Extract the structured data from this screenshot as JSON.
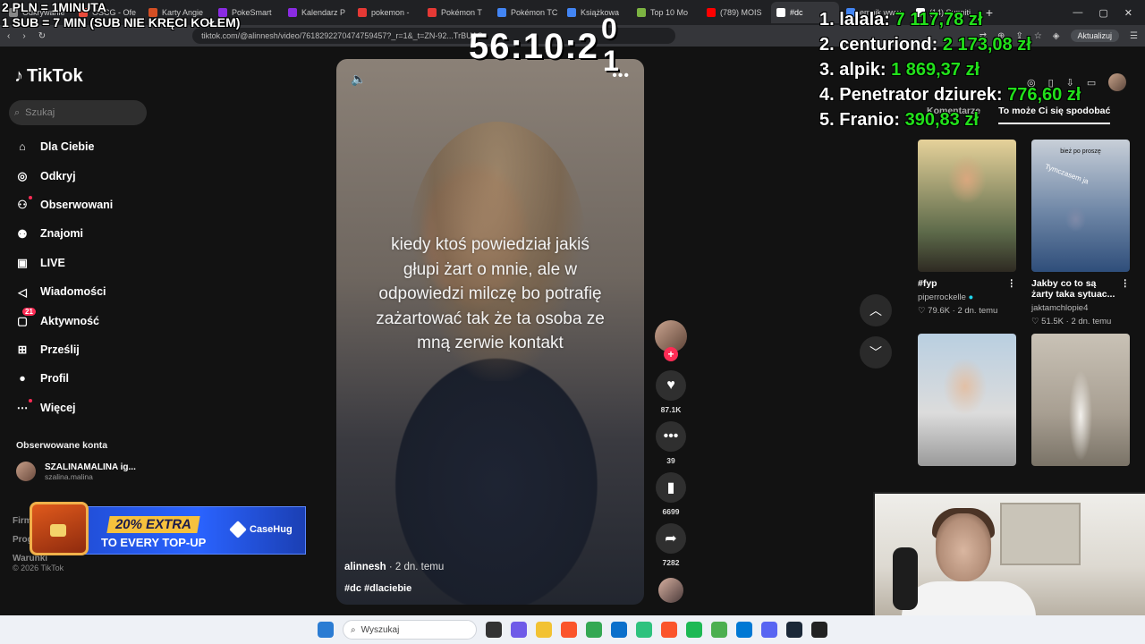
{
  "overlay": {
    "line1": "2 PLN =  1MINUTA",
    "line2": "1 SUB = 7 MIN (SUB NIE KRĘCI KOŁEM)",
    "timer": "56:10:2",
    "timer_digit_top": "0",
    "timer_digit_bottom": "1"
  },
  "leaderboard": [
    {
      "rank": "1.",
      "name": "lalala:",
      "amount": "7 117,78 zł"
    },
    {
      "rank": "2.",
      "name": "centuriond:",
      "amount": "2 173,08 zł"
    },
    {
      "rank": "3.",
      "name": "alpik:",
      "amount": "1 869,37 zł"
    },
    {
      "rank": "4.",
      "name": "Penetrator dziurek:",
      "amount": "776,60 zł"
    },
    {
      "rank": "5.",
      "name": "Franio:",
      "amount": "390,83 zł"
    }
  ],
  "browser": {
    "tabs": [
      {
        "label": "Odkrywanie",
        "color": "#888888"
      },
      {
        "label": "OSCG - Ofe",
        "color": "#e94b3c"
      },
      {
        "label": "Karty Angie",
        "color": "#d44f24"
      },
      {
        "label": "PokeSmart",
        "color": "#8a2be2"
      },
      {
        "label": "Kalendarz P",
        "color": "#8a2be2"
      },
      {
        "label": "pokemon -",
        "color": "#e53935"
      },
      {
        "label": "Pokémon T",
        "color": "#e53935"
      },
      {
        "label": "Pokémon TC",
        "color": "#4285f4"
      },
      {
        "label": "Książkowa",
        "color": "#4285f4"
      },
      {
        "label": "Top 10 Mo",
        "color": "#7cb342"
      },
      {
        "label": "(789) MOIS",
        "color": "#ff0000"
      },
      {
        "label": "#dc",
        "color": "#ffffff"
      },
      {
        "label": "empik www",
        "color": "#4285f4"
      },
      {
        "label": "(14) Sunniti",
        "color": "#ffffff"
      }
    ],
    "url": "tiktok.com/@alinnesh/video/7618292270474759457?_r=1&_t=ZN-92...TrBUAS",
    "update_label": "Aktualizuj"
  },
  "sidebar": {
    "logo": "TikTok",
    "search_placeholder": "Szukaj",
    "items": [
      {
        "label": "Dla Ciebie",
        "icon": "home-icon"
      },
      {
        "label": "Odkryj",
        "icon": "compass-icon"
      },
      {
        "label": "Obserwowani",
        "icon": "following-icon"
      },
      {
        "label": "Znajomi",
        "icon": "friends-icon"
      },
      {
        "label": "LIVE",
        "icon": "live-icon"
      },
      {
        "label": "Wiadomości",
        "icon": "messages-icon"
      },
      {
        "label": "Aktywność",
        "icon": "activity-icon",
        "badge": "21"
      },
      {
        "label": "Prześlij",
        "icon": "upload-icon"
      },
      {
        "label": "Profil",
        "icon": "profile-icon"
      },
      {
        "label": "Więcej",
        "icon": "more-icon"
      }
    ],
    "followed_title": "Obserwowane konta",
    "followed": {
      "name": "SZALINAMALINA ig...",
      "handle": "szalina.malina"
    },
    "footer": [
      "Firma",
      "Program",
      "Warunki"
    ],
    "copyright": "© 2026 TikTok"
  },
  "promo": {
    "headline": "20% EXTRA",
    "sub": "TO EVERY TOP-UP",
    "brand": "CaseHug"
  },
  "video": {
    "caption": "kiedy ktoś powiedział jakiś głupi żart o mnie, ale w odpowiedzi milczę bo potrafię zażartować tak że ta osoba ze mną zerwie kontakt",
    "author": "alinnesh",
    "time": "· 2 dn. temu",
    "tags": "#dc #dlaciebie",
    "likes": "87.1K",
    "comments": "39",
    "saves": "6699",
    "shares": "7282"
  },
  "right_panel": {
    "tabs": [
      "Komentarze",
      "To może Ci się spodobać"
    ],
    "cards": [
      {
        "title": "#fyp",
        "user": "piperrockelle",
        "verified": true,
        "likes": "79.6K",
        "time": "2 dn. temu"
      },
      {
        "title": "Jakby co to są żarty taka sytuac...",
        "user": "jaktamchlopie4",
        "verified": false,
        "likes": "51.5K",
        "time": "2 dn. temu",
        "overlay1": "bież po proszę",
        "overlay2": "Tymczasem ja"
      },
      {
        "title": "",
        "user": "",
        "verified": false,
        "likes": "",
        "time": ""
      },
      {
        "title": "",
        "user": "",
        "verified": false,
        "likes": "",
        "time": ""
      }
    ]
  },
  "taskbar": {
    "search_placeholder": "Wyszukaj"
  }
}
